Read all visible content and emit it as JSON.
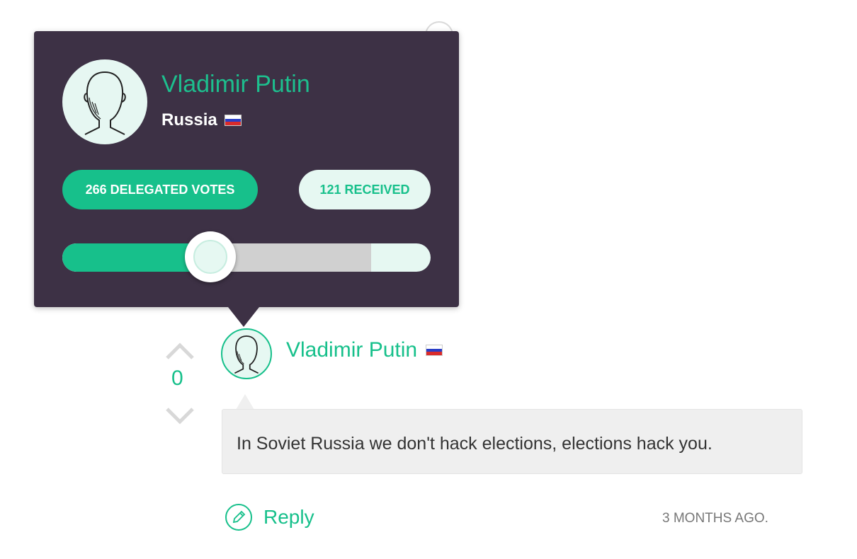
{
  "popover": {
    "name": "Vladimir Putin",
    "country": "Russia",
    "country_flag_icon": "russia-flag-icon",
    "delegated_label": "266 DELEGATED VOTES",
    "received_label": "121 RECEIVED",
    "slider": {
      "fill_fraction": 0.4,
      "secondary_fraction": 0.84
    }
  },
  "comment": {
    "author": "Vladimir Putin",
    "author_flag_icon": "russia-flag-icon",
    "vote_count": "0",
    "text": "In Soviet Russia we don't hack elections, elections hack you.",
    "reply_label": "Reply",
    "timestamp": "3 MONTHS AGO."
  },
  "background": {
    "ghost_count": "0"
  },
  "colors": {
    "accent": "#17c08b",
    "popover_bg": "#3d3145",
    "light_accent": "#e6f8f2",
    "bubble_bg": "#efefef"
  }
}
